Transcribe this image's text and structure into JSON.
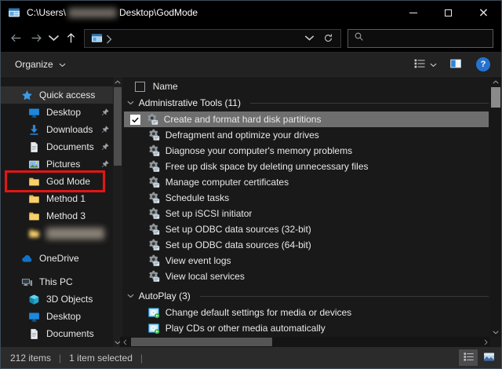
{
  "titlebar": {
    "path_prefix": "C:\\Users\\",
    "path_suffix": "Desktop\\GodMode"
  },
  "navbar": {
    "search_value": ""
  },
  "toolbar": {
    "organize_label": "Organize",
    "help_glyph": "?"
  },
  "sidebar": {
    "items": [
      {
        "label": "Quick access",
        "icon": "star",
        "level": 0,
        "highlighted": true
      },
      {
        "label": "Desktop",
        "icon": "monitor",
        "level": 1,
        "pinned": true
      },
      {
        "label": "Downloads",
        "icon": "download",
        "level": 1,
        "pinned": true
      },
      {
        "label": "Documents",
        "icon": "document",
        "level": 1,
        "pinned": true
      },
      {
        "label": "Pictures",
        "icon": "picture",
        "level": 1,
        "pinned": true
      },
      {
        "label": "God Mode",
        "icon": "folder",
        "level": 1,
        "annotated": true
      },
      {
        "label": "Method 1",
        "icon": "folder",
        "level": 1
      },
      {
        "label": "Method 3",
        "icon": "folder",
        "level": 1
      },
      {
        "label": "",
        "icon": "folder",
        "level": 1,
        "redacted": true
      },
      {
        "label": "OneDrive",
        "icon": "cloud",
        "level": 0,
        "gap_before": 10
      },
      {
        "label": "This PC",
        "icon": "pc",
        "level": 0,
        "gap_before": 8
      },
      {
        "label": "3D Objects",
        "icon": "cube",
        "level": 1
      },
      {
        "label": "Desktop",
        "icon": "monitor",
        "level": 1
      },
      {
        "label": "Documents",
        "icon": "document",
        "level": 1
      }
    ]
  },
  "main": {
    "column_header": "Name",
    "groups": [
      {
        "label": "Administrative Tools (11)",
        "items": [
          {
            "label": "Create and format hard disk partitions",
            "icon": "admin-tool",
            "selected": true,
            "checked": true
          },
          {
            "label": "Defragment and optimize your drives",
            "icon": "admin-tool"
          },
          {
            "label": "Diagnose your computer's memory problems",
            "icon": "admin-tool"
          },
          {
            "label": "Free up disk space by deleting unnecessary files",
            "icon": "admin-tool"
          },
          {
            "label": "Manage computer certificates",
            "icon": "admin-tool"
          },
          {
            "label": "Schedule tasks",
            "icon": "admin-tool"
          },
          {
            "label": "Set up iSCSI initiator",
            "icon": "admin-tool"
          },
          {
            "label": "Set up ODBC data sources (32-bit)",
            "icon": "admin-tool"
          },
          {
            "label": "Set up ODBC data sources (64-bit)",
            "icon": "admin-tool"
          },
          {
            "label": "View event logs",
            "icon": "admin-tool"
          },
          {
            "label": "View local services",
            "icon": "admin-tool"
          }
        ]
      },
      {
        "label": "AutoPlay (3)",
        "items": [
          {
            "label": "Change default settings for media or devices",
            "icon": "autoplay"
          },
          {
            "label": "Play CDs or other media automatically",
            "icon": "autoplay"
          }
        ]
      }
    ]
  },
  "statusbar": {
    "items_count": "212 items",
    "selection": "1 item selected"
  },
  "colors": {
    "accent": "#0078d7",
    "annotation": "#e31515",
    "selected_row": "#6e6e6e",
    "folder": "#f5c846"
  }
}
